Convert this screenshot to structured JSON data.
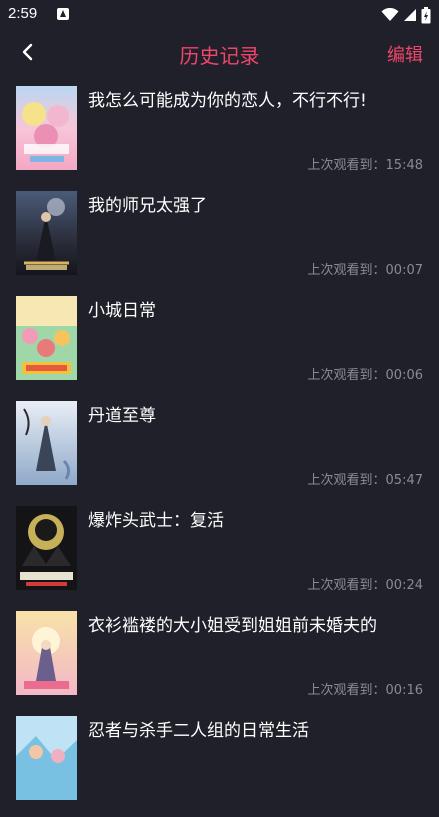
{
  "status_bar": {
    "time": "2:59",
    "icons": [
      "app-notification-icon",
      "wifi-icon",
      "signal-icon",
      "battery-icon"
    ]
  },
  "header": {
    "title": "历史记录",
    "edit_label": "编辑",
    "back_icon": "chevron-left-icon",
    "accent_color": "#f0466a"
  },
  "history": {
    "watched_prefix": "上次观看到：",
    "items": [
      {
        "title": "我怎么可能成为你的恋人，不行不行!",
        "time": "15:48"
      },
      {
        "title": "我的师兄太强了",
        "time": "00:07"
      },
      {
        "title": "小城日常",
        "time": "00:06"
      },
      {
        "title": "丹道至尊",
        "time": "05:47"
      },
      {
        "title": "爆炸头武士：复活",
        "time": "00:24"
      },
      {
        "title": "衣衫褴褛的大小姐受到姐姐前未婚夫的",
        "time": "00:16"
      },
      {
        "title": "忍者与杀手二人组的日常生活",
        "time": ""
      }
    ]
  },
  "colors": {
    "background": "#1f202a",
    "muted_text": "#8a8b94"
  }
}
